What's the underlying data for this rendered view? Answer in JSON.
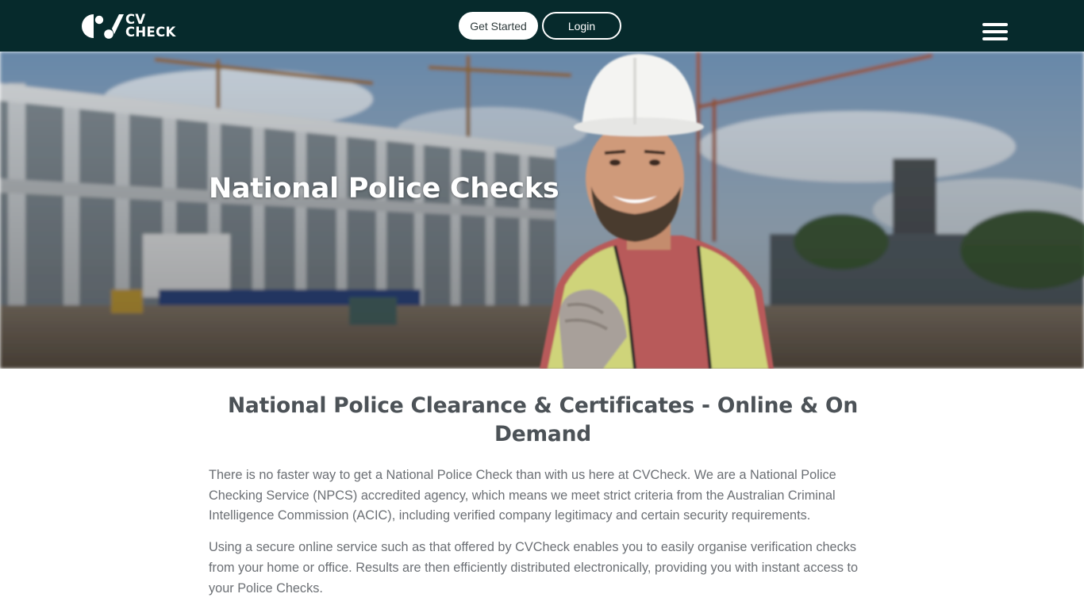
{
  "header": {
    "logo_line1": "CV",
    "logo_line2": "CHECK",
    "get_started_label": "Get Started",
    "login_label": "Login",
    "menu_icon": "hamburger-menu-icon"
  },
  "hero": {
    "title": "National Police Checks",
    "image": "construction-worker-hard-hat-photo"
  },
  "main": {
    "heading": "National Police Clearance & Certificates - Online & On Demand",
    "paragraphs": [
      "There is no faster way to get a National Police Check than with us here at CVCheck. We are a National Police Checking Service (NPCS) accredited agency, which means we meet strict criteria from the Australian Criminal Intelligence Commission (ACIC), including verified company legitimacy and certain security requirements.",
      "Using a secure online service such as that offered by CVCheck enables you to easily organise verification checks from your home or office. Results are then efficiently distributed electronically, providing you with instant access to your Police Checks."
    ]
  },
  "colors": {
    "header_bg": "#062a2c",
    "heading_text": "#4c5257",
    "body_text": "#6b6f74"
  }
}
